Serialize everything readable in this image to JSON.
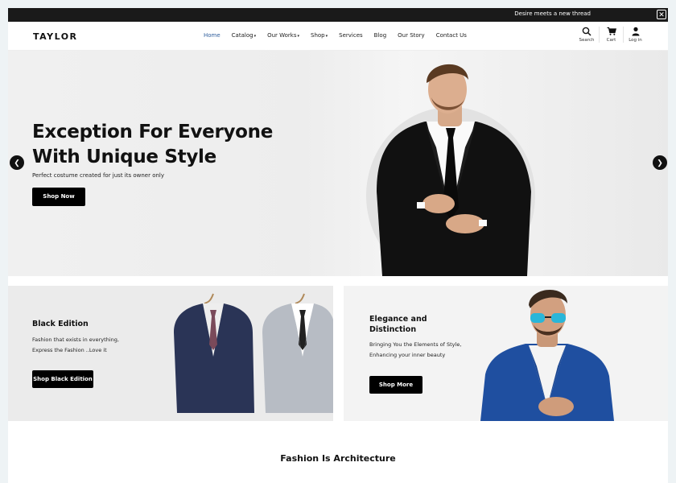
{
  "announcement": {
    "text": "Desire meets a new thread",
    "close_icon": "close-icon"
  },
  "header": {
    "logo": "TAYLOR",
    "nav": [
      {
        "label": "Home",
        "dropdown": false,
        "active": true
      },
      {
        "label": "Catalog",
        "dropdown": true,
        "active": false
      },
      {
        "label": "Our Works",
        "dropdown": true,
        "active": false
      },
      {
        "label": "Shop",
        "dropdown": true,
        "active": false
      },
      {
        "label": "Services",
        "dropdown": false,
        "active": false
      },
      {
        "label": "Blog",
        "dropdown": false,
        "active": false
      },
      {
        "label": "Our Story",
        "dropdown": false,
        "active": false
      },
      {
        "label": "Contact Us",
        "dropdown": false,
        "active": false
      }
    ],
    "actions": [
      {
        "label": "Search",
        "icon": "search-icon"
      },
      {
        "label": "Cart",
        "icon": "cart-icon"
      },
      {
        "label": "Log in",
        "icon": "user-icon"
      }
    ]
  },
  "hero": {
    "title": "Exception For Everyone\nWith Unique Style",
    "subtitle": "Perfect costume created for just its owner only",
    "button": "Shop Now",
    "prev_icon": "chevron-left-icon",
    "next_icon": "chevron-right-icon"
  },
  "promo_left": {
    "title": "Black Edition",
    "text": "Fashion that exists in everything,\nExpress the Fashion ..Love it",
    "button": "Shop Black Edition"
  },
  "promo_right": {
    "title": "Elegance and\nDistinction",
    "text": "Bringing You the Elements of Style,\nEnhancing your inner beauty",
    "button": "Shop More"
  },
  "section": {
    "title": "Fashion Is Architecture"
  },
  "colors": {
    "accent": "#2f5e9c",
    "button": "#000000",
    "topbar": "#1a1a1a"
  }
}
